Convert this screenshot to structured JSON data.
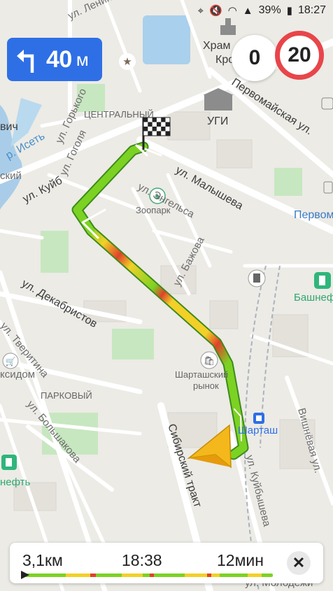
{
  "status": {
    "battery": "39%",
    "time": "18:27",
    "icons": [
      "location-icon",
      "mute-icon",
      "wifi-icon",
      "signal-icon",
      "battery-icon"
    ]
  },
  "turn": {
    "distance": "40",
    "unit": "м",
    "icon": "turn-left-icon"
  },
  "speed": {
    "current": "0",
    "limit": "20"
  },
  "map": {
    "labels": {
      "ul_lenina": "ул. Ленина",
      "hram": "Храм",
      "kro": "Кро",
      "tsentralny": "ЦЕНТРАЛЬНЫЙ",
      "ugi": "УГИ",
      "pervomayskaya": "Первомайская ул.",
      "ul_gorkogo": "ул. Горького",
      "ul_gogolya": "ул. Гоголя",
      "r_iset": "р. Исеть",
      "vich": "вич",
      "skiy": "ский",
      "ul_kuyb": "ул. Куйб",
      "ul_malysheva": "ул. Малышева",
      "ul_engelsa": "ул. Энгельса",
      "zoopark": "Зоопарк",
      "pervomay": "Первомайс",
      "ul_bazhova": "ул. Бажова",
      "bashneft": "Башнеф",
      "ul_dekabristov": "ул. Декабристов",
      "ul_tveritina": "ул. Тверитина",
      "ksidom": "ксидом",
      "shartash_market_1": "Шарташский",
      "shartash_market_2": "рынок",
      "parkovy": "ПАРКОВЫЙ",
      "ul_bolshakova": "ул. Большакова",
      "shartash": "Шарташ",
      "vishnevaya": "Вишнёвая ул.",
      "sibirsky": "Сибирский тракт",
      "ul_kuybysheva": "ул. Куйбышева",
      "neft": "нефть",
      "molodezhi": "ул. Молодёжи"
    }
  },
  "trip": {
    "distance": "3,1км",
    "arrival": "18:38",
    "duration": "12мин",
    "close_icon": "close-icon",
    "colors": {
      "green": "#7cd223",
      "yellow": "#f2d028",
      "red": "#e0412b",
      "accent": "#2e6fe6"
    }
  }
}
